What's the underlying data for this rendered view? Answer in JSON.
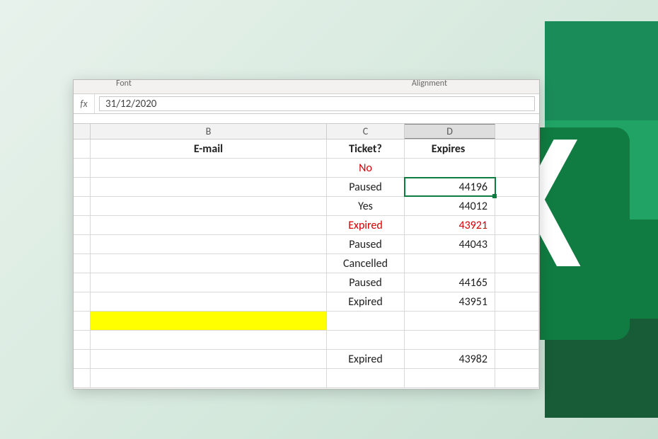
{
  "ribbon": {
    "group_font": "Font",
    "group_alignment": "Alignment"
  },
  "formula_bar": {
    "fx": "fx",
    "value": "31/12/2020"
  },
  "columns": {
    "b": "B",
    "c": "C",
    "d": "D"
  },
  "headers": {
    "b": "E-mail",
    "c": "Ticket?",
    "d": "Expires"
  },
  "rows": [
    {
      "b": "",
      "c": "No",
      "d": "",
      "c_red": true,
      "d_red": false,
      "b_highlight": false
    },
    {
      "b": "",
      "c": "Paused",
      "d": "44196",
      "c_red": false,
      "d_red": false,
      "b_highlight": false,
      "selected": true
    },
    {
      "b": "",
      "c": "Yes",
      "d": "44012",
      "c_red": false,
      "d_red": false,
      "b_highlight": false
    },
    {
      "b": "",
      "c": "Expired",
      "d": "43921",
      "c_red": true,
      "d_red": true,
      "b_highlight": false
    },
    {
      "b": "",
      "c": "Paused",
      "d": "44043",
      "c_red": false,
      "d_red": false,
      "b_highlight": false
    },
    {
      "b": "",
      "c": "Cancelled",
      "d": "",
      "c_red": false,
      "d_red": false,
      "b_highlight": false
    },
    {
      "b": "",
      "c": "Paused",
      "d": "44165",
      "c_red": false,
      "d_red": false,
      "b_highlight": false
    },
    {
      "b": "",
      "c": "Expired",
      "d": "43951",
      "c_red": false,
      "d_red": false,
      "b_highlight": false
    },
    {
      "b": "",
      "c": "",
      "d": "",
      "c_red": false,
      "d_red": false,
      "b_highlight": true
    },
    {
      "b": "",
      "c": "",
      "d": "",
      "c_red": false,
      "d_red": false,
      "b_highlight": false
    },
    {
      "b": "",
      "c": "Expired",
      "d": "43982",
      "c_red": false,
      "d_red": false,
      "b_highlight": false
    },
    {
      "b": "",
      "c": "",
      "d": "",
      "c_red": false,
      "d_red": false,
      "b_highlight": false
    }
  ]
}
